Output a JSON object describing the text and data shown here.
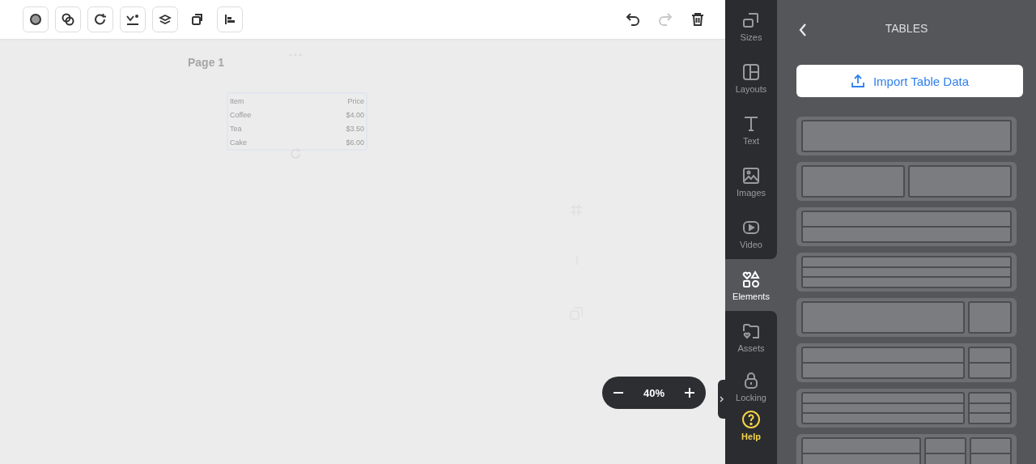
{
  "canvas": {
    "page_title": "Page 1",
    "table": {
      "header": [
        "Item",
        "Price"
      ],
      "rows": [
        [
          "Coffee",
          "$4.00"
        ],
        [
          "Tea",
          "$3.50"
        ],
        [
          "Cake",
          "$6.00"
        ]
      ]
    }
  },
  "zoom": {
    "value": "40%"
  },
  "nav": [
    {
      "label": "Sizes",
      "kind": "nav",
      "selected": false
    },
    {
      "label": "Layouts",
      "kind": "nav",
      "selected": false
    },
    {
      "label": "Text",
      "kind": "nav",
      "selected": false
    },
    {
      "label": "Images",
      "kind": "nav",
      "selected": false
    },
    {
      "label": "Video",
      "kind": "nav",
      "selected": false
    },
    {
      "label": "Elements",
      "kind": "nav",
      "selected": true
    },
    {
      "label": "Assets",
      "kind": "nav",
      "selected": false
    },
    {
      "label": "Locking",
      "kind": "nav",
      "selected": false
    },
    {
      "label": "Help",
      "kind": "help",
      "selected": false
    }
  ],
  "panel": {
    "title": "TABLES",
    "import_button": "Import Table Data"
  }
}
